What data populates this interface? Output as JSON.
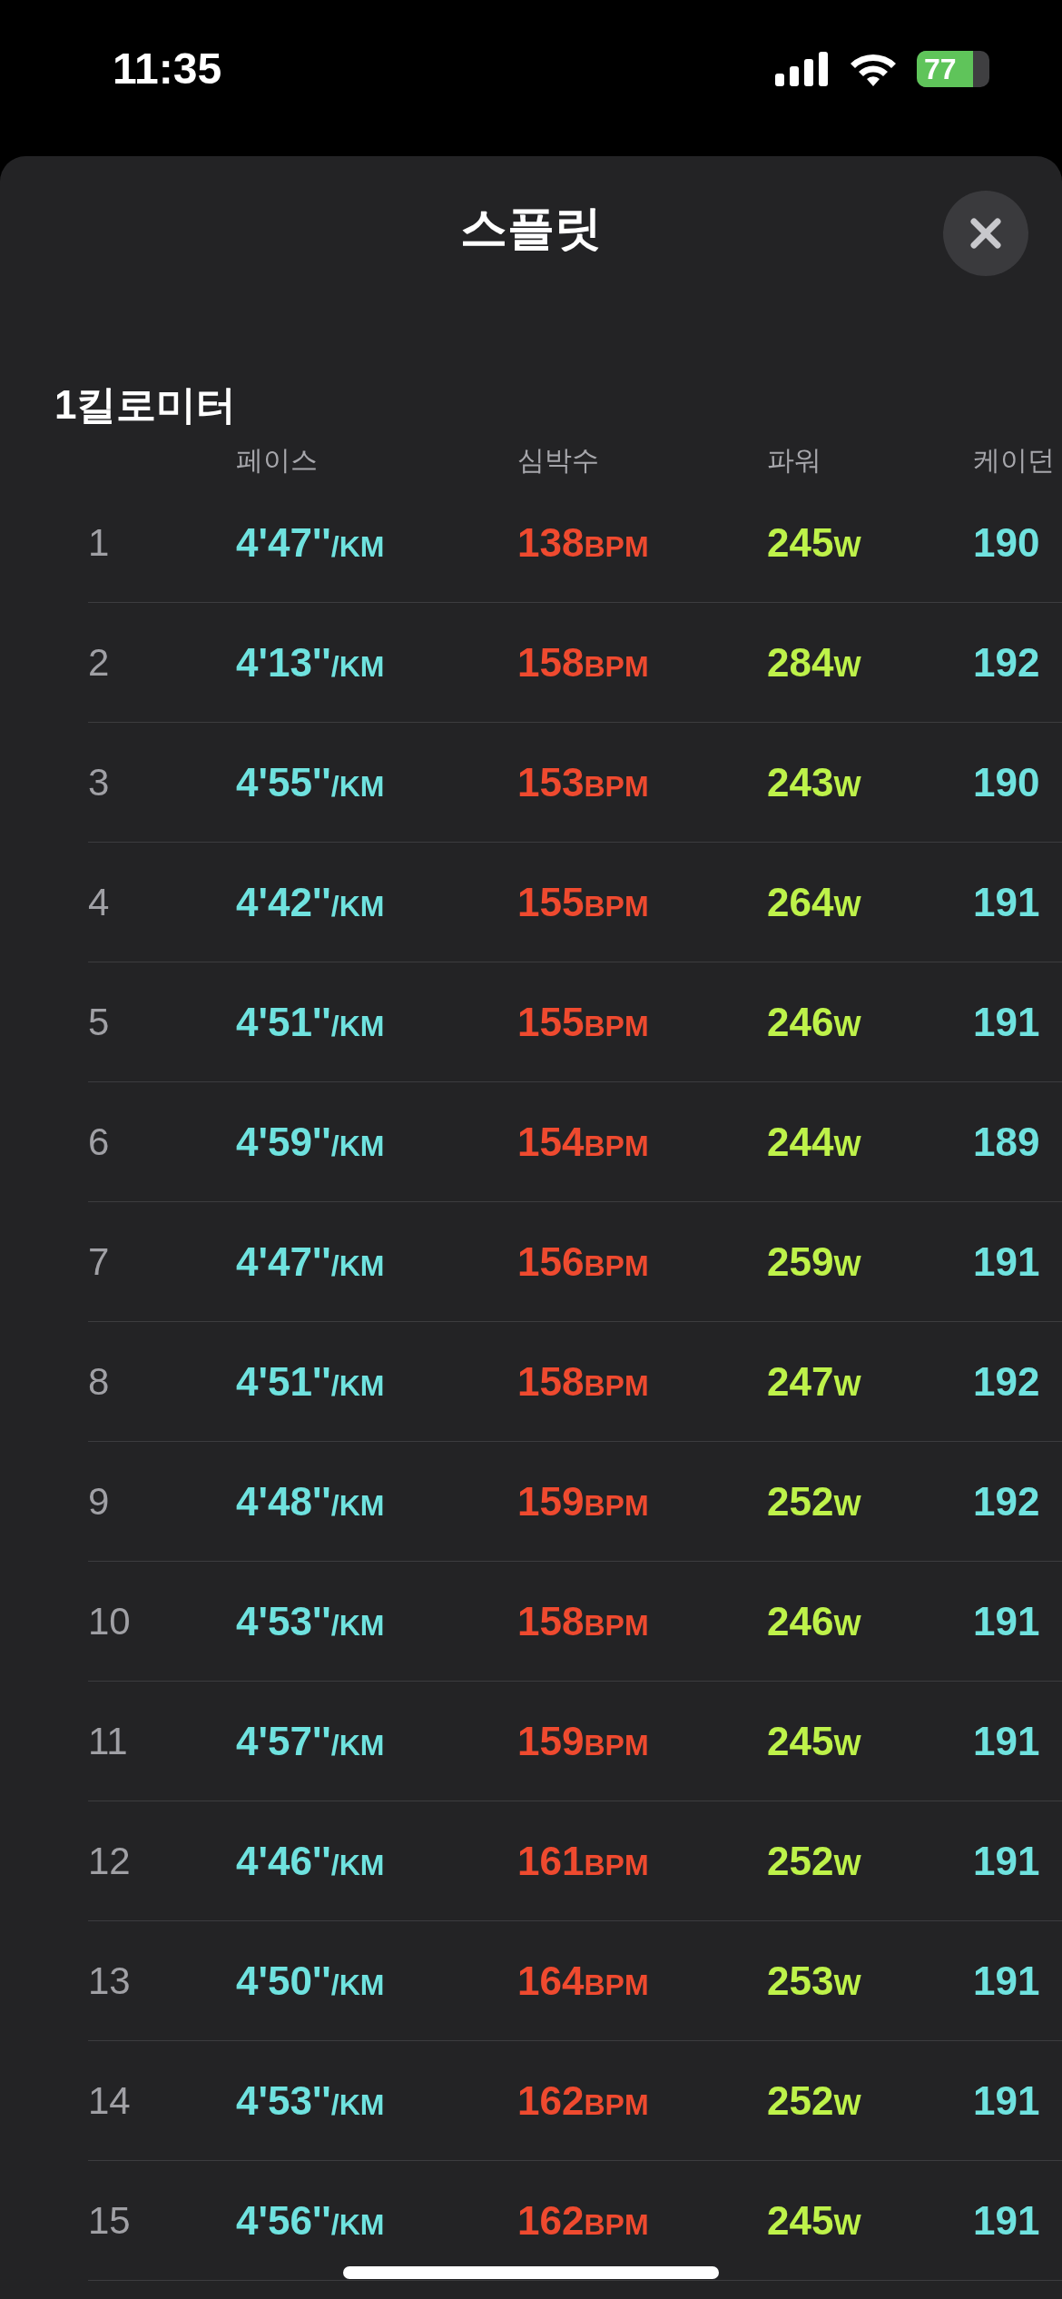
{
  "status_bar": {
    "time": "11:35",
    "battery": "77"
  },
  "sheet": {
    "title": "스플릿",
    "section": "1킬로미터",
    "columns": [
      "페이스",
      "심박수",
      "파워",
      "케이던"
    ],
    "rows": [
      {
        "split": "1",
        "pace": "4'47''",
        "pace_unit": "/KM",
        "heart_rate": "138",
        "heart_rate_unit": "BPM",
        "power": "245",
        "power_unit": "W",
        "cadence": "190"
      },
      {
        "split": "2",
        "pace": "4'13''",
        "pace_unit": "/KM",
        "heart_rate": "158",
        "heart_rate_unit": "BPM",
        "power": "284",
        "power_unit": "W",
        "cadence": "192"
      },
      {
        "split": "3",
        "pace": "4'55''",
        "pace_unit": "/KM",
        "heart_rate": "153",
        "heart_rate_unit": "BPM",
        "power": "243",
        "power_unit": "W",
        "cadence": "190"
      },
      {
        "split": "4",
        "pace": "4'42''",
        "pace_unit": "/KM",
        "heart_rate": "155",
        "heart_rate_unit": "BPM",
        "power": "264",
        "power_unit": "W",
        "cadence": "191"
      },
      {
        "split": "5",
        "pace": "4'51''",
        "pace_unit": "/KM",
        "heart_rate": "155",
        "heart_rate_unit": "BPM",
        "power": "246",
        "power_unit": "W",
        "cadence": "191"
      },
      {
        "split": "6",
        "pace": "4'59''",
        "pace_unit": "/KM",
        "heart_rate": "154",
        "heart_rate_unit": "BPM",
        "power": "244",
        "power_unit": "W",
        "cadence": "189"
      },
      {
        "split": "7",
        "pace": "4'47''",
        "pace_unit": "/KM",
        "heart_rate": "156",
        "heart_rate_unit": "BPM",
        "power": "259",
        "power_unit": "W",
        "cadence": "191"
      },
      {
        "split": "8",
        "pace": "4'51''",
        "pace_unit": "/KM",
        "heart_rate": "158",
        "heart_rate_unit": "BPM",
        "power": "247",
        "power_unit": "W",
        "cadence": "192"
      },
      {
        "split": "9",
        "pace": "4'48''",
        "pace_unit": "/KM",
        "heart_rate": "159",
        "heart_rate_unit": "BPM",
        "power": "252",
        "power_unit": "W",
        "cadence": "192"
      },
      {
        "split": "10",
        "pace": "4'53''",
        "pace_unit": "/KM",
        "heart_rate": "158",
        "heart_rate_unit": "BPM",
        "power": "246",
        "power_unit": "W",
        "cadence": "191"
      },
      {
        "split": "11",
        "pace": "4'57''",
        "pace_unit": "/KM",
        "heart_rate": "159",
        "heart_rate_unit": "BPM",
        "power": "245",
        "power_unit": "W",
        "cadence": "191"
      },
      {
        "split": "12",
        "pace": "4'46''",
        "pace_unit": "/KM",
        "heart_rate": "161",
        "heart_rate_unit": "BPM",
        "power": "252",
        "power_unit": "W",
        "cadence": "191"
      },
      {
        "split": "13",
        "pace": "4'50''",
        "pace_unit": "/KM",
        "heart_rate": "164",
        "heart_rate_unit": "BPM",
        "power": "253",
        "power_unit": "W",
        "cadence": "191"
      },
      {
        "split": "14",
        "pace": "4'53''",
        "pace_unit": "/KM",
        "heart_rate": "162",
        "heart_rate_unit": "BPM",
        "power": "252",
        "power_unit": "W",
        "cadence": "191"
      },
      {
        "split": "15",
        "pace": "4'56''",
        "pace_unit": "/KM",
        "heart_rate": "162",
        "heart_rate_unit": "BPM",
        "power": "245",
        "power_unit": "W",
        "cadence": "191"
      }
    ]
  }
}
